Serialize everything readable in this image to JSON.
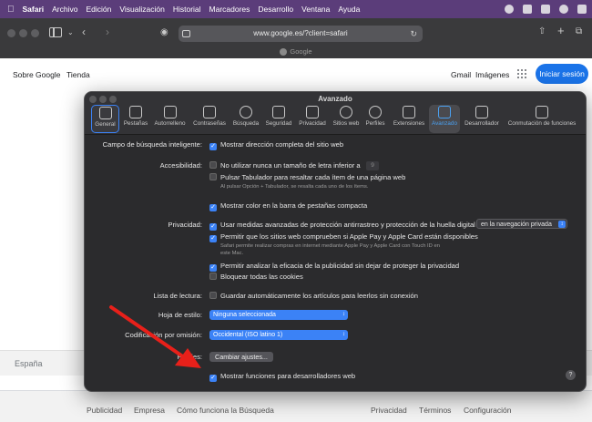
{
  "menubar": {
    "app": "Safari",
    "items": [
      "Archivo",
      "Edición",
      "Visualización",
      "Historial",
      "Marcadores",
      "Desarrollo",
      "Ventana",
      "Ayuda"
    ]
  },
  "browser": {
    "url": "www.google.es/?client=safari",
    "tab_title": "Google"
  },
  "google": {
    "about": "Sobre Google",
    "store": "Tienda",
    "gmail": "Gmail",
    "images": "Imágenes",
    "signin": "Iniciar sesión",
    "country": "España",
    "footer": [
      "Publicidad",
      "Empresa",
      "Cómo funciona la Búsqueda",
      "Privacidad",
      "Términos",
      "Configuración"
    ]
  },
  "settings": {
    "title": "Avanzado",
    "tabs": [
      "General",
      "Pestañas",
      "Autorrelleno",
      "Contraseñas",
      "Búsqueda",
      "Seguridad",
      "Privacidad",
      "Sitios web",
      "Perfiles",
      "Extensiones",
      "Avanzado",
      "Desarrollador",
      "Conmutación de funciones"
    ],
    "smart_search_label": "Campo de búsqueda inteligente:",
    "smart_search_option": "Mostrar dirección completa del sitio web",
    "accessibility_label": "Accesibilidad:",
    "font_size_option": "No utilizar nunca un tamaño de letra inferior a",
    "font_size_value": "9",
    "tab_highlight_option": "Pulsar Tabulador para resaltar cada ítem de una página web",
    "tab_highlight_note": "Al pulsar Opción + Tabulador, se resalta cada uno de los ítems.",
    "compact_color_option": "Mostrar color en la barra de pestañas compacta",
    "privacy_label": "Privacidad:",
    "tracking_option": "Usar medidas avanzadas de protección antirrastreo y protección de la huella digital",
    "tracking_scope": "en la navegación privada",
    "applepay_option": "Permitir que los sitios web comprueben si Apple Pay y Apple Card están disponibles",
    "applepay_note1": "Safari permite realizar compras en internet mediante Apple Pay y Apple Card con Touch ID en",
    "applepay_note2": "este Mac.",
    "ad_measure_option": "Permitir analizar la eficacia de la publicidad sin dejar de proteger la privacidad",
    "block_cookies_option": "Bloquear todas las cookies",
    "reading_list_label": "Lista de lectura:",
    "reading_list_option": "Guardar automáticamente los artículos para leerlos sin conexión",
    "stylesheet_label": "Hoja de estilo:",
    "stylesheet_value": "Ninguna seleccionada",
    "encoding_label": "Codificación por omisión:",
    "encoding_value": "Occidental (ISO latino 1)",
    "proxies_label": "Proxies:",
    "proxies_button": "Cambiar ajustes...",
    "dev_features_option": "Mostrar funciones para desarrolladores web",
    "help": "?"
  },
  "colors": {
    "menubar": "#5b3d7a",
    "accent": "#3b82f6",
    "annotation_arrow": "#e8201a"
  }
}
